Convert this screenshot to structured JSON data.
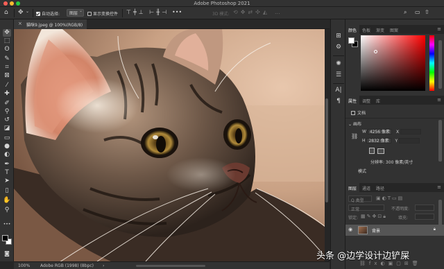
{
  "window": {
    "title": "Adobe Photoshop 2021"
  },
  "options_bar": {
    "auto_select_label": "自动选择:",
    "auto_select_value": "图层",
    "show_transform_label": "显示变换控件",
    "mode_3d_label": "3D 模式:",
    "more_label": "..."
  },
  "document": {
    "tab_label": "猫咪9.jpeg @ 100%(RGB/8)"
  },
  "status_bar": {
    "zoom": "100%",
    "profile": "Adobe RGB (1998) (8bpc)"
  },
  "toolbar": {
    "tools": [
      {
        "name": "move-tool",
        "glyph": "✥"
      },
      {
        "name": "marquee-tool",
        "glyph": "⬚"
      },
      {
        "name": "lasso-tool",
        "glyph": "ʘ"
      },
      {
        "name": "quick-select-tool",
        "glyph": "✎"
      },
      {
        "name": "crop-tool",
        "glyph": "⌗"
      },
      {
        "name": "frame-tool",
        "glyph": "⊠"
      },
      {
        "name": "eyedropper-tool",
        "glyph": "⁄"
      },
      {
        "name": "healing-tool",
        "glyph": "✚"
      },
      {
        "name": "brush-tool",
        "glyph": "✐"
      },
      {
        "name": "stamp-tool",
        "glyph": "⚲"
      },
      {
        "name": "history-brush-tool",
        "glyph": "↺"
      },
      {
        "name": "eraser-tool",
        "glyph": "◪"
      },
      {
        "name": "gradient-tool",
        "glyph": "▭"
      },
      {
        "name": "blur-tool",
        "glyph": "●"
      },
      {
        "name": "dodge-tool",
        "glyph": "◐"
      },
      {
        "name": "pen-tool",
        "glyph": "✒"
      },
      {
        "name": "type-tool",
        "glyph": "T"
      },
      {
        "name": "path-select-tool",
        "glyph": "➤"
      },
      {
        "name": "rectangle-tool",
        "glyph": "▯"
      },
      {
        "name": "hand-tool",
        "glyph": "✋"
      },
      {
        "name": "zoom-tool",
        "glyph": "⚲"
      },
      {
        "name": "more-tools",
        "glyph": "•••"
      }
    ]
  },
  "color_panel": {
    "tabs": [
      "颜色",
      "色板",
      "渐变",
      "图案"
    ]
  },
  "properties_panel": {
    "tabs": [
      "属性",
      "调整",
      "库"
    ],
    "doc_label": "文档",
    "canvas_section": "画布",
    "width_label": "W",
    "width_value": "4256 像素",
    "height_label": "H",
    "height_value": "2832 像素",
    "x_label": "X",
    "y_label": "Y",
    "resolution": "分辨率: 300 像素/英寸",
    "mode_label": "模式"
  },
  "layers_panel": {
    "tabs": [
      "图层",
      "通道",
      "路径"
    ],
    "kind_filter": "Q 类型",
    "blend_mode": "正常",
    "opacity_label": "不透明度:",
    "lock_label": "锁定:",
    "fill_label": "填充:",
    "layer_name": "背景"
  },
  "watermark": "头条 @边学设计边铲屎"
}
